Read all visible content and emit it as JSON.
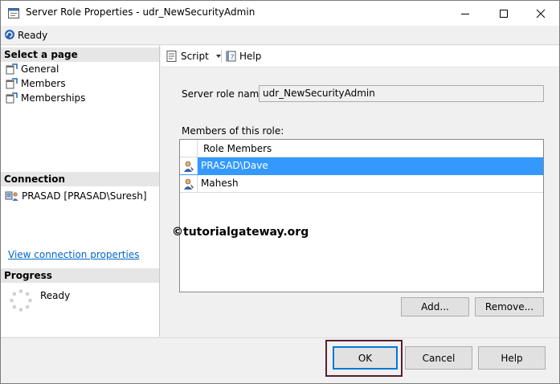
{
  "window": {
    "title": "Server Role Properties - udr_NewSecurityAdmin",
    "minimize_icon": "minimize-icon",
    "maximize_icon": "maximize-icon",
    "close_icon": "close-icon"
  },
  "status": {
    "text": "Ready",
    "icon": "refresh-icon"
  },
  "sidebar": {
    "select_header": "Select a page",
    "pages": [
      {
        "label": "General",
        "icon": "page-icon"
      },
      {
        "label": "Members",
        "icon": "page-icon"
      },
      {
        "label": "Memberships",
        "icon": "page-icon"
      }
    ],
    "connection_header": "Connection",
    "connection_text": "PRASAD [PRASAD\\Suresh]",
    "connection_link": "View connection properties",
    "progress_header": "Progress",
    "progress_text": "Ready"
  },
  "toolbar": {
    "script_label": "Script",
    "help_label": "Help"
  },
  "form": {
    "role_name_label": "Server role name:",
    "role_name_value": "udr_NewSecurityAdmin",
    "members_label": "Members of this role:",
    "column_header": "Role Members",
    "members": [
      "PRASAD\\Dave",
      "Mahesh"
    ],
    "add_button": "Add...",
    "remove_button": "Remove..."
  },
  "watermark": "©tutorialgateway.org",
  "footer": {
    "ok": "OK",
    "cancel": "Cancel",
    "help": "Help"
  },
  "colors": {
    "selection": "#3399ff",
    "link": "#0066cc",
    "highlight_border": "#5a1e2e"
  }
}
